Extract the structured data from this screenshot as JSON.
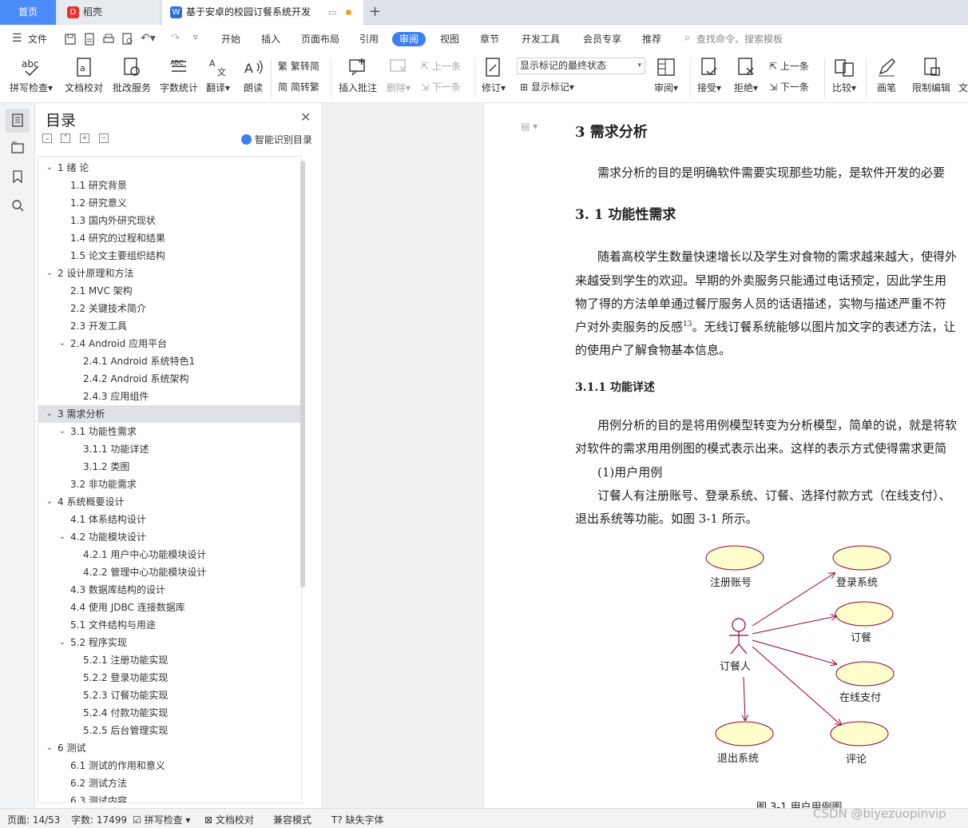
{
  "tabs": {
    "home": "首页",
    "daoke": "稻壳",
    "doc": "基于安卓的校园订餐系统开发"
  },
  "menu": {
    "file": "文件",
    "items": [
      "开始",
      "插入",
      "页面布局",
      "引用",
      "审阅",
      "视图",
      "章节",
      "开发工具",
      "会员专享",
      "推荐"
    ],
    "search": "查找命令、搜索模板"
  },
  "ribbon": {
    "spell": "拼写检查",
    "proof": "文档校对",
    "batch": "批改服务",
    "count": "字数统计",
    "translate": "翻译",
    "read": "朗读",
    "t2s": "繁转简",
    "s2t": "简转繁",
    "insert_comment": "插入批注",
    "delete": "删除",
    "prev": "上一条",
    "next": "下一条",
    "revise": "修订",
    "markup_state": "显示标记的最终状态",
    "show_markup": "显示标记",
    "review": "审阅",
    "accept": "接受",
    "reject": "拒绝",
    "prev2": "上一条",
    "next2": "下一条",
    "compare": "比较",
    "pen": "画笔",
    "restrict": "限制编辑",
    "doc_cut": "文"
  },
  "toc": {
    "title": "目录",
    "smart": "智能识别目录",
    "items": [
      {
        "text": "1  绪  论",
        "level": 1,
        "exp": true
      },
      {
        "text": "1.1  研究背景",
        "level": 2
      },
      {
        "text": "1.2  研究意义",
        "level": 2
      },
      {
        "text": "1.3  国内外研究现状",
        "level": 2
      },
      {
        "text": "1.4  研究的过程和结果",
        "level": 2
      },
      {
        "text": "1.5  论文主要组织结构",
        "level": 2
      },
      {
        "text": "2  设计原理和方法",
        "level": 1,
        "exp": true
      },
      {
        "text": "2.1 MVC 架构",
        "level": 2
      },
      {
        "text": "2.2  关键技术简介",
        "level": 2
      },
      {
        "text": "2.3  开发工具",
        "level": 2
      },
      {
        "text": "2.4 Android 应用平台",
        "level": 2,
        "exp": true
      },
      {
        "text": "2.4.1 Android 系统特色1",
        "level": 3
      },
      {
        "text": "2.4.2 Android 系统架构",
        "level": 3
      },
      {
        "text": "2.4.3  应用组件",
        "level": 3
      },
      {
        "text": "3  需求分析",
        "level": 1,
        "exp": true,
        "sel": true
      },
      {
        "text": "3.1  功能性需求",
        "level": 2,
        "exp": true
      },
      {
        "text": "3.1.1 功能详述",
        "level": 3
      },
      {
        "text": "3.1.2  类图",
        "level": 3
      },
      {
        "text": "3.2  非功能需求",
        "level": 2
      },
      {
        "text": "4  系统概要设计",
        "level": 1,
        "exp": true
      },
      {
        "text": "4.1  体系结构设计",
        "level": 2
      },
      {
        "text": "4.2  功能模块设计",
        "level": 2,
        "exp": true
      },
      {
        "text": "4.2.1  用户中心功能模块设计",
        "level": 3
      },
      {
        "text": "4.2.2  管理中心功能模块设计",
        "level": 3
      },
      {
        "text": "4.3  数据库结构的设计",
        "level": 2
      },
      {
        "text": "4.4  使用 JDBC 连接数据库",
        "level": 2
      },
      {
        "text": "5.1 文件结构与用途",
        "level": 2
      },
      {
        "text": "5.2  程序实现",
        "level": 2,
        "exp": true
      },
      {
        "text": "5.2.1  注册功能实现",
        "level": 3
      },
      {
        "text": "5.2.2  登录功能实现",
        "level": 3
      },
      {
        "text": "5.2.3  订餐功能实现",
        "level": 3
      },
      {
        "text": "5.2.4  付款功能实现",
        "level": 3
      },
      {
        "text": "5.2.5  后台管理实现",
        "level": 3
      },
      {
        "text": "6  测试",
        "level": 1,
        "exp": true
      },
      {
        "text": "6.1  测试的作用和意义",
        "level": 2
      },
      {
        "text": "6.2  测试方法",
        "level": 2
      },
      {
        "text": "6.3  测试内容",
        "level": 2
      }
    ]
  },
  "doc": {
    "h1": "3  需求分析",
    "p1": "需求分析的目的是明确软件需要实现那些功能，是软件开发的必要",
    "h2": "3. 1  功能性需求",
    "p2": [
      "随着高校学生数量快速增长以及学生对食物的需求越来越大，使得外",
      "来越受到学生的欢迎。早期的外卖服务只能通过电话预定，因此学生用",
      "物了得的方法单单通过餐厅服务人员的话语描述，实物与描述严重不符",
      "户对外卖服务的反感",
      "的使用户了解食物基本信息。"
    ],
    "p2_tail": "。无线订餐系统能够以图片加文字的表述方法，让",
    "p2_sup": "13",
    "h3": "3.1.1 功能详述",
    "p3": [
      "用例分析的目的是将用例模型转变为分析模型，简单的说，就是将软",
      "对软件的需求用用例图的模式表示出来。这样的表示方式使得需求更简",
      "(1)用户用例",
      "订餐人有注册账号、登录系统、订餐、选择付款方式（在线支付）、",
      "退出系统等功能。如图 3-1 所示。"
    ],
    "caption": "图 3-1 用户用例图"
  },
  "usecase": {
    "actor": "订餐人",
    "cases": [
      "注册账号",
      "登录系统",
      "订餐",
      "在线支付",
      "退出系统",
      "评论"
    ]
  },
  "status": {
    "page": "页面: 14/53",
    "words": "字数: 17499",
    "spell": "拼写检查",
    "proof": "文档校对",
    "compat": "兼容模式",
    "missing": "缺失字体",
    "watermark": "CSDN @biyezuopinvip"
  },
  "colors": {
    "accent": "#3d7ff6",
    "usecase_fill": "#ffffcc",
    "usecase_stroke": "#990033",
    "arrow": "#990033"
  }
}
